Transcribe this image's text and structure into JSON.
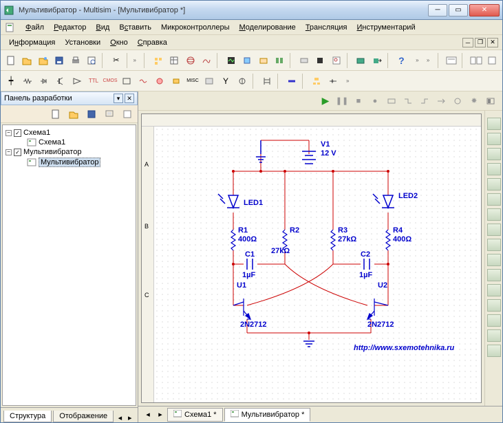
{
  "titlebar": {
    "text": "Мультивибратор - Multisim - [Мультивибратор *]"
  },
  "menu1": {
    "file": "Файл",
    "edit": "Редактор",
    "view": "Вид",
    "insert": "Вставить",
    "mcu": "Микроконтроллеры",
    "simulate": "Моделирование",
    "transfer": "Трансляция",
    "tools": "Инструментарий"
  },
  "menu2": {
    "info": "Информация",
    "setup": "Установки",
    "window": "Окно",
    "help": "Справка"
  },
  "panel": {
    "title": "Панель разработки"
  },
  "tree": {
    "n0": "Схема1",
    "n0_0": "Схема1",
    "n1": "Мультивибратор",
    "n1_0": "Мультивибратор"
  },
  "left_tabs": {
    "structure": "Структура",
    "display": "Отображение"
  },
  "doc_tabs": {
    "t0": "Схема1 *",
    "t1": "Мультивибратор *"
  },
  "circuit": {
    "v1_name": "V1",
    "v1_val": "12 V",
    "led1": "LED1",
    "led2": "LED2",
    "r1_name": "R1",
    "r1_val": "400Ω",
    "r2_name": "R2",
    "r2_val": "27kΩ",
    "r3_name": "R3",
    "r3_val": "27kΩ",
    "r4_name": "R4",
    "r4_val": "400Ω",
    "c1_name": "C1",
    "c1_val": "1µF",
    "c2_name": "C2",
    "c2_val": "1µF",
    "u1": "U1",
    "u2": "U2",
    "q1": "2N2712",
    "q2": "2N2712",
    "url": "http://www.sxemotehnika.ru"
  },
  "ruler": {
    "a": "A",
    "b": "B",
    "c": "C"
  }
}
